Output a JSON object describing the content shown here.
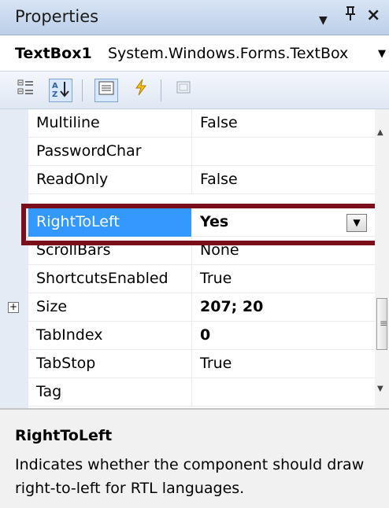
{
  "panel": {
    "title": "Properties",
    "dropdown_icon": "▼",
    "pin_icon": "ᚹ",
    "close_icon": "×"
  },
  "object_selector": {
    "name": "TextBox1",
    "type": "System.Windows.Forms.TextBox"
  },
  "toolbar": {
    "buttons": [
      "categorized-icon",
      "alphabetical-icon",
      "properties-icon",
      "events-icon",
      "property-pages-icon"
    ]
  },
  "properties": [
    {
      "name": "Multiline",
      "value": "False"
    },
    {
      "name": "PasswordChar",
      "value": ""
    },
    {
      "name": "ReadOnly",
      "value": "False"
    },
    {
      "name": "RightToLeft",
      "value": "Yes"
    },
    {
      "name": "ScrollBars",
      "value": "None"
    },
    {
      "name": "ShortcutsEnabled",
      "value": "True"
    },
    {
      "name": "Size",
      "value": "207; 20"
    },
    {
      "name": "TabIndex",
      "value": "0"
    },
    {
      "name": "TabStop",
      "value": "True"
    },
    {
      "name": "Tag",
      "value": ""
    }
  ],
  "selected_property": "RightToLeft",
  "description": {
    "title": "RightToLeft",
    "text": "Indicates whether the component should draw right-to-left for RTL languages."
  },
  "colors": {
    "selection": "#3399ff",
    "highlight_border": "#7a0f1b"
  }
}
